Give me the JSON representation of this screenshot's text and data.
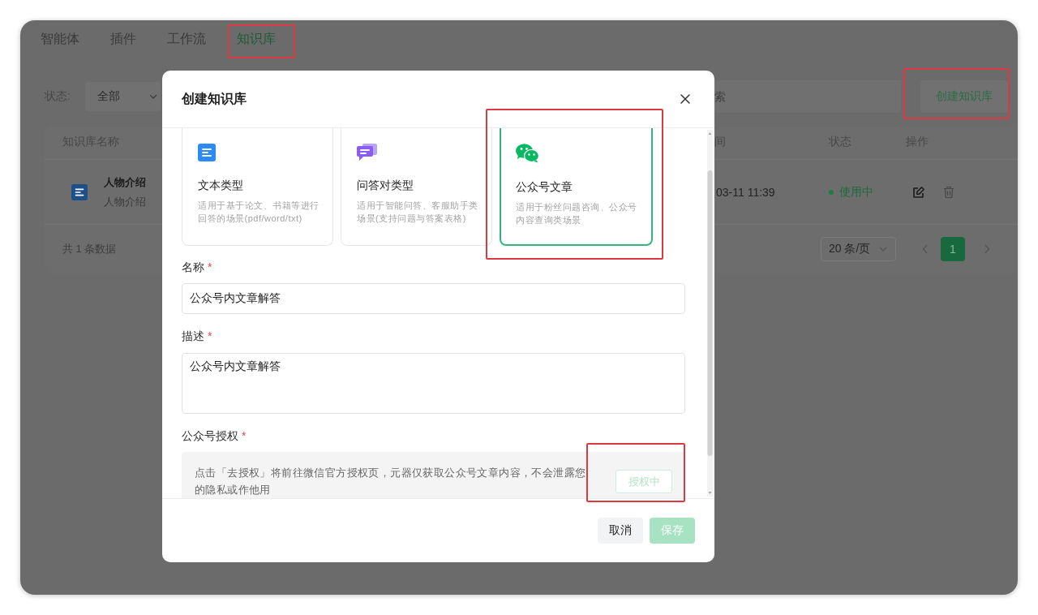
{
  "nav": {
    "tabs": [
      {
        "label": "智能体",
        "selected": false,
        "highlighted": false
      },
      {
        "label": "插件",
        "selected": false,
        "highlighted": false
      },
      {
        "label": "工作流",
        "selected": false,
        "highlighted": false
      },
      {
        "label": "知识库",
        "selected": true,
        "highlighted": true
      }
    ]
  },
  "filters": {
    "status_label": "状态:",
    "status_value": "全部",
    "search_placeholder": "索"
  },
  "create_button": {
    "label": "创建知识库",
    "highlighted": true
  },
  "table": {
    "columns": [
      "知识库名称",
      "间",
      "状态",
      "操作"
    ],
    "rows": [
      {
        "title": "人物介绍",
        "subtitle": "人物介绍",
        "time": "03-11 11:39",
        "status": "使用中"
      }
    ],
    "total": "共 1 条数据",
    "page_size": "20 条/页",
    "pages": [
      {
        "label": "1",
        "selected": true
      }
    ]
  },
  "modal": {
    "title": "创建知识库",
    "types": [
      {
        "kind": "text",
        "title": "文本类型",
        "description": "适用于基于论文、书籍等进行回答的场景(pdf/word/txt)",
        "selected": false,
        "highlighted": false
      },
      {
        "kind": "qa",
        "title": "问答对类型",
        "description": "适用于智能问答、客服助手类场景(支持问题与答案表格)",
        "selected": false,
        "highlighted": false
      },
      {
        "kind": "wechat",
        "title": "公众号文章",
        "description": "适用于粉丝问题咨询、公众号内容查询类场景",
        "selected": true,
        "highlighted": true
      }
    ],
    "fields": [
      {
        "kind": "input",
        "label": "名称",
        "required_mark": "*",
        "value": "公众号内文章解答"
      },
      {
        "kind": "textarea",
        "label": "描述",
        "required_mark": "*",
        "value": "公众号内文章解答"
      }
    ],
    "auth": {
      "label": "公众号授权",
      "required_mark": "*",
      "notice": "点击「去授权」将前往微信官方授权页，元器仅获取公众号文章内容，不会泄露您的隐私或作他用",
      "button": {
        "label": "授权中",
        "disabled": true,
        "highlighted": true
      }
    },
    "buttons": [
      {
        "kind": "cancel",
        "label": "取消",
        "disabled": false
      },
      {
        "kind": "primary",
        "label": "保存",
        "disabled": true
      }
    ]
  }
}
